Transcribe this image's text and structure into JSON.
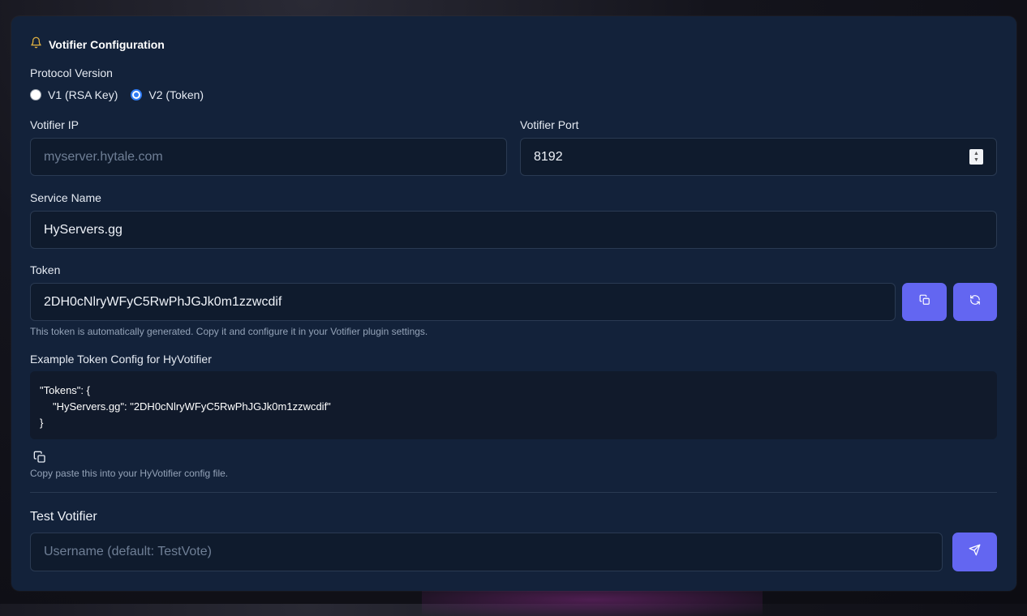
{
  "header": {
    "title": "Votifier Configuration",
    "icon": "bell-icon",
    "icon_color": "#e3b341"
  },
  "protocol": {
    "label": "Protocol Version",
    "options": [
      {
        "label": "V1 (RSA Key)",
        "checked": false
      },
      {
        "label": "V2 (Token)",
        "checked": true
      }
    ]
  },
  "votifier_ip": {
    "label": "Votifier IP",
    "value": "",
    "placeholder": "myserver.hytale.com"
  },
  "votifier_port": {
    "label": "Votifier Port",
    "value": "8192"
  },
  "service_name": {
    "label": "Service Name",
    "value": "HyServers.gg"
  },
  "token": {
    "label": "Token",
    "value": "2DH0cNlryWFyC5RwPhJGJk0m1zzwcdif",
    "helper": "This token is automatically generated. Copy it and configure it in your Votifier plugin settings.",
    "copy_icon": "copy-icon",
    "regenerate_icon": "refresh-icon"
  },
  "example": {
    "label": "Example Token Config for HyVotifier",
    "line1": "\"Tokens\": {",
    "line2": "\"HyServers.gg\": \"2DH0cNlryWFyC5RwPhJGJk0m1zzwcdif\"",
    "line3": "}",
    "helper": "Copy paste this into your HyVotifier config file."
  },
  "test": {
    "title": "Test Votifier",
    "placeholder": "Username (default: TestVote)",
    "send_icon": "send-icon"
  },
  "colors": {
    "accent": "#6366f1",
    "card": "#13223a",
    "input_bg": "#0f1b2d"
  }
}
